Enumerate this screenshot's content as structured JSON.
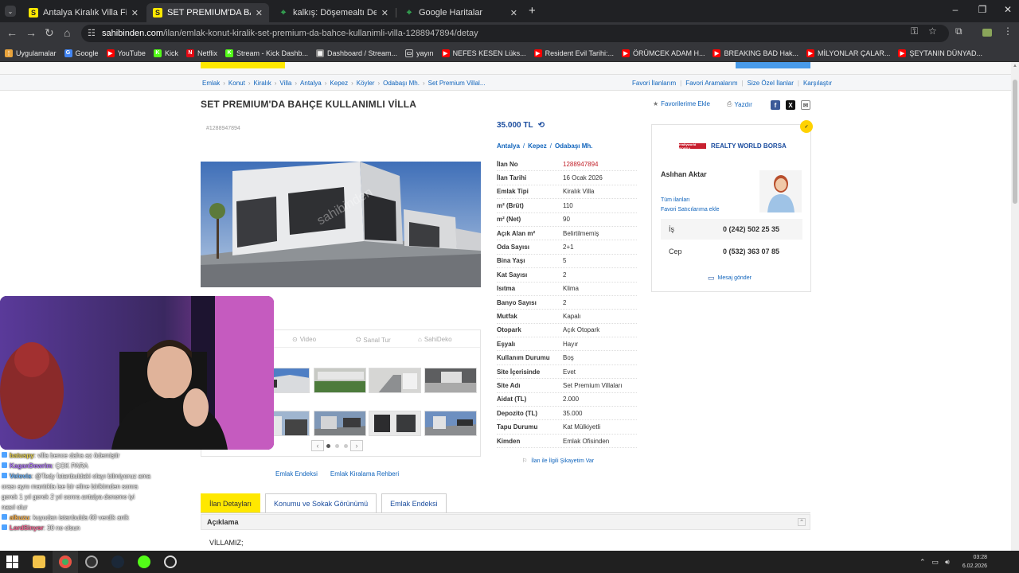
{
  "browser": {
    "tabs": [
      {
        "title": "Antalya Kiralık Villa Fiyatları sahibinden",
        "favicon": "sahibinden-icon",
        "active": false
      },
      {
        "title": "SET PREMIUM'DA BAHÇE KULLANIMLI",
        "favicon": "sahibinden-icon",
        "active": true
      },
      {
        "title": "kalkış: Döşemealtı Devlet Hastanesi",
        "favicon": "maps-pin-icon",
        "active": false
      },
      {
        "title": "Google Haritalar",
        "favicon": "maps-pin-icon",
        "active": false
      }
    ],
    "url_host": "sahibinden.com",
    "url_path": "/ilan/emlak-konut-kiralik-set-premium-da-bahce-kullanimli-villa-1288947894/detay",
    "bookmarks": [
      {
        "label": "Uygulamalar",
        "icon": "apps-icon",
        "color": "#e8a33c"
      },
      {
        "label": "Google",
        "icon": "google-icon",
        "color": "#4285f4"
      },
      {
        "label": "YouTube",
        "icon": "youtube-icon",
        "color": "#ff0000"
      },
      {
        "label": "Kick",
        "icon": "kick-icon",
        "color": "#53fc18"
      },
      {
        "label": "Netflix",
        "icon": "netflix-icon",
        "color": "#e50914"
      },
      {
        "label": "Stream - Kick Dashb...",
        "icon": "kick-icon",
        "color": "#53fc18"
      },
      {
        "label": "Dashboard / Stream...",
        "icon": "dashboard-icon",
        "color": "#888888"
      },
      {
        "label": "yayın",
        "icon": "folder-icon",
        "color": "#bbbbbb"
      },
      {
        "label": "NEFES KESEN Lüks...",
        "icon": "youtube-icon",
        "color": "#ff0000"
      },
      {
        "label": "Resident Evil Tarihi:...",
        "icon": "youtube-icon",
        "color": "#ff0000"
      },
      {
        "label": "ÖRÜMCEK ADAM H...",
        "icon": "youtube-icon",
        "color": "#ff0000"
      },
      {
        "label": "BREAKING BAD Hak...",
        "icon": "youtube-icon",
        "color": "#ff0000"
      },
      {
        "label": "MİLYONLAR ÇALAR...",
        "icon": "youtube-icon",
        "color": "#ff0000"
      },
      {
        "label": "ŞEYTANIN DÜNYAD...",
        "icon": "youtube-icon",
        "color": "#ff0000"
      }
    ]
  },
  "breadcrumbs": [
    "Emlak",
    "Konut",
    "Kiralık",
    "Villa",
    "Antalya",
    "Kepez",
    "Köyler",
    "Odabaşı Mh.",
    "Set Premium Villal..."
  ],
  "top_links": [
    "Favori İlanlarım",
    "Favori Aramalarım",
    "Size Özel İlanlar",
    "Karşılaştır"
  ],
  "listing": {
    "title": "SET PREMIUM'DA BAHÇE KULLANIMLI VİLLA",
    "favorite_label": "Favorilerime Ekle",
    "print_label": "Yazdır",
    "ad_no_small": "#1288947894",
    "price": "35.000 TL",
    "location": [
      "Antalya",
      "Kepez",
      "Odabaşı Mh."
    ],
    "attributes": [
      {
        "k": "İlan No",
        "v": "1288947894",
        "red": true
      },
      {
        "k": "İlan Tarihi",
        "v": "16 Ocak 2026"
      },
      {
        "k": "Emlak Tipi",
        "v": "Kiralık Villa"
      },
      {
        "k": "m² (Brüt)",
        "v": "110"
      },
      {
        "k": "m² (Net)",
        "v": "90"
      },
      {
        "k": "Açık Alan m²",
        "v": "Belirtilmemiş"
      },
      {
        "k": "Oda Sayısı",
        "v": "2+1"
      },
      {
        "k": "Bina Yaşı",
        "v": "5"
      },
      {
        "k": "Kat Sayısı",
        "v": "2"
      },
      {
        "k": "Isıtma",
        "v": "Klima"
      },
      {
        "k": "Banyo Sayısı",
        "v": "2"
      },
      {
        "k": "Mutfak",
        "v": "Kapalı"
      },
      {
        "k": "Otopark",
        "v": "Açık Otopark"
      },
      {
        "k": "Eşyalı",
        "v": "Hayır"
      },
      {
        "k": "Kullanım Durumu",
        "v": "Boş"
      },
      {
        "k": "Site İçerisinde",
        "v": "Evet"
      },
      {
        "k": "Site Adı",
        "v": "Set Premium Villaları"
      },
      {
        "k": "Aidat (TL)",
        "v": "2.000"
      },
      {
        "k": "Depozito (TL)",
        "v": "35.000"
      },
      {
        "k": "Tapu Durumu",
        "v": "Kat Mülkiyetli"
      },
      {
        "k": "Kimden",
        "v": "Emlak Ofisinden"
      }
    ],
    "complaint": "İlan ile İlgili Şikayetim Var",
    "media_tabs": [
      "Video",
      "Sanal Tur",
      "SahiDeko"
    ],
    "links": [
      "Emlak Endeksi",
      "Emlak Kiralama Rehberi"
    ]
  },
  "seller": {
    "brand": "REALTY WORLD BORSA",
    "logo_text": "realtyworld BORSA",
    "name": "Aslıhan Aktar",
    "all_ads": "Tüm ilanları",
    "add_fav": "Favori Satıcılarıma ekle",
    "phones": [
      {
        "label": "İş",
        "value": "0 (242) 502 25 35"
      },
      {
        "label": "Cep",
        "value": "0 (532) 363 07 85"
      }
    ],
    "message": "Mesaj gönder"
  },
  "bottom_tabs": [
    "İlan Detayları",
    "Konumu ve Sokak Görünümü",
    "Emlak Endeksi"
  ],
  "description": {
    "heading": "Açıklama",
    "text": "VİLLAMIZ;"
  },
  "chat": [
    {
      "user": "batuspy",
      "color": "#e8d24a",
      "msg": ": villa bence daha az ödemiştir"
    },
    {
      "user": "KaganDewrim",
      "color": "#b57cff",
      "msg": ": ÇOK PARA"
    },
    {
      "user": "Velovis",
      "color": "#6cb6ff",
      "msg": ": @Tedy İstanbuldaki olayı bilmiyoruz ama"
    },
    {
      "user": "",
      "color": "#ffffff",
      "msg": "orası aynı mantıkla ise bir eline birikimden sonra"
    },
    {
      "user": "",
      "color": "#ffffff",
      "msg": "gerek 1 yıl gerek 2 yıl sonra antalya deneme iyi"
    },
    {
      "user": "",
      "color": "#ffffff",
      "msg": "nasıl olur"
    },
    {
      "user": "alkuzu",
      "color": "#ffb347",
      "msg": ": kuyudan istanbulda 60 verdik anlk"
    },
    {
      "user": "LordSinyor",
      "color": "#ff6b9a",
      "msg": ": 30 ne olsun"
    }
  ],
  "clock": {
    "time": "03:28",
    "date": "6.02.2026"
  }
}
